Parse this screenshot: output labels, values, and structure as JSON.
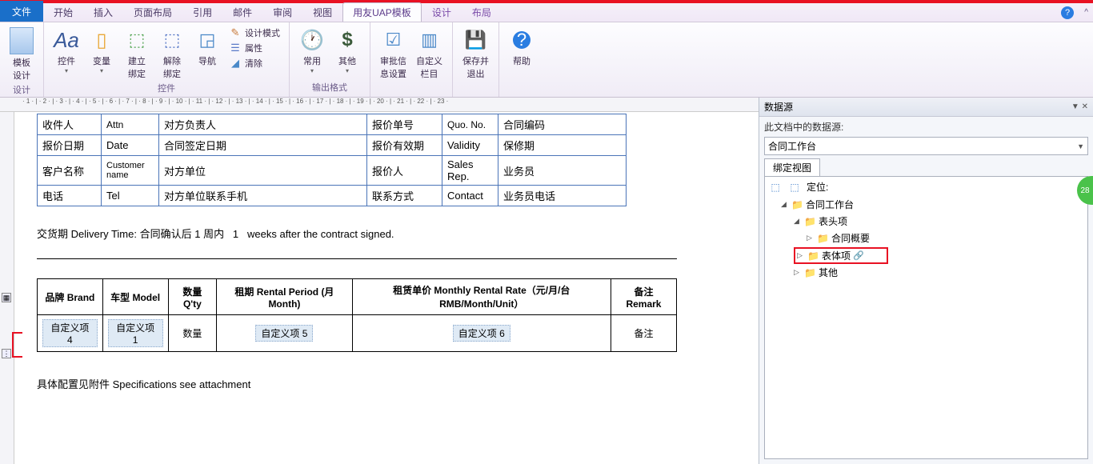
{
  "ribbon": {
    "tabs": {
      "file": "文件",
      "home": "开始",
      "insert": "插入",
      "page_layout": "页面布局",
      "reference": "引用",
      "mail": "邮件",
      "review": "审阅",
      "view": "视图",
      "uap": "用友UAP模板",
      "design": "设计",
      "layout": "布局"
    },
    "groups": {
      "design": {
        "label": "设计",
        "template_design": "模板\n设计"
      },
      "controls": {
        "label": "控件",
        "control": "控件",
        "variable": "变量",
        "build_bind": "建立\n绑定",
        "unbind": "解除\n绑定",
        "navigate": "导航",
        "design_mode": "设计模式",
        "property": "属性",
        "clear": "清除"
      },
      "output": {
        "label": "输出格式",
        "common": "常用",
        "other": "其他"
      },
      "approve": {
        "approve_info": "审批信\n息设置",
        "custom_col": "自定义\n栏目",
        "save_exit": "保存并\n退出",
        "help": "帮助"
      }
    }
  },
  "doc": {
    "info_rows": [
      {
        "c1": "收件人",
        "c2": "Attn",
        "c3": "对方负责人",
        "c4": "报价单号",
        "c5": "Quo. No.",
        "c6": "合同编码"
      },
      {
        "c1": "报价日期",
        "c2": "Date",
        "c3": "合同签定日期",
        "c4": "报价有效期",
        "c5": "Validity",
        "c6": "保修期"
      },
      {
        "c1": "客户名称",
        "c2": "Customer name",
        "c3": "对方单位",
        "c4": "报价人",
        "c5": "Sales Rep.",
        "c6": "业务员"
      },
      {
        "c1": "电话",
        "c2": "Tel",
        "c3": "对方单位联系手机",
        "c4": "联系方式",
        "c5": "Contact",
        "c6": "业务员电话"
      }
    ],
    "delivery_prefix": "交货期 Delivery Time: 合同确认后",
    "delivery_n1": "1",
    "delivery_mid": "周内",
    "delivery_n2": "1",
    "delivery_suffix": "weeks after the contract signed.",
    "product_headers": {
      "brand": "品牌 Brand",
      "model": "车型 Model",
      "qty": "数量 Q'ty",
      "period": "租期 Rental Period (月 Month)",
      "rate": "租赁单价 Monthly Rental Rate（元/月/台 RMB/Month/Unit）",
      "remark": "备注 Remark"
    },
    "product_row": {
      "brand": "自定义项 4",
      "model": "自定义项 1",
      "qty": "数量",
      "period": "自定义项 5",
      "rate": "自定义项 6",
      "remark": "备注"
    },
    "footer": "具体配置见附件  Specifications see attachment"
  },
  "side": {
    "title": "数据源",
    "subtitle": "此文档中的数据源:",
    "combo": "合同工作台",
    "tab": "绑定视图",
    "locate": "定位:",
    "tree": {
      "root": "合同工作台",
      "header_items": "表头项",
      "contract_summary": "合同概要",
      "body_items": "表体项",
      "other": "其他"
    }
  },
  "badge": "28"
}
